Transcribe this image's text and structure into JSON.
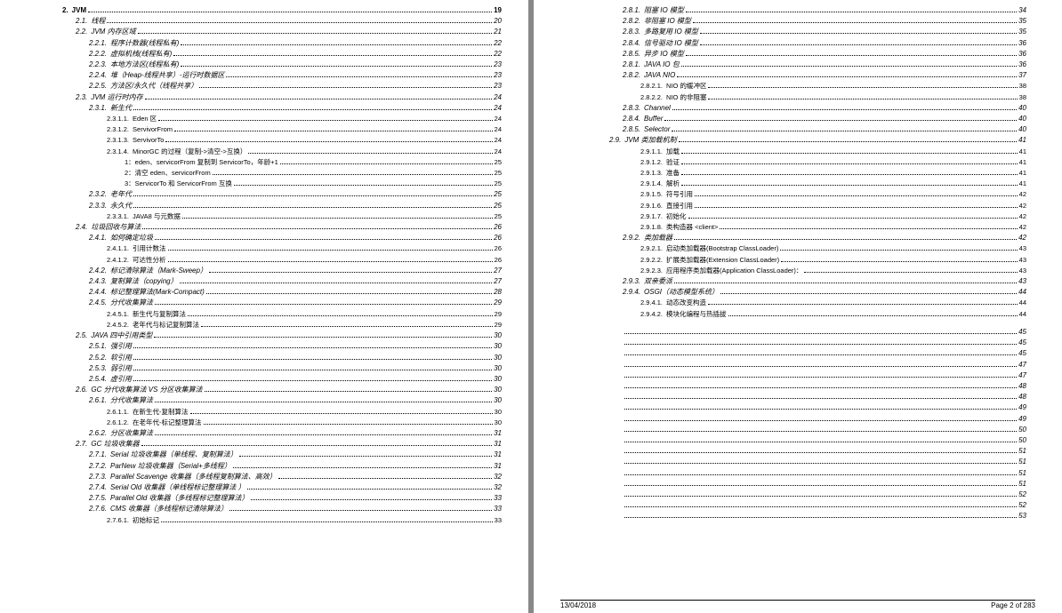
{
  "footer": {
    "date": "13/04/2018",
    "pageinfo": "Page 2 of 283"
  },
  "left": [
    {
      "lv": 1,
      "num": "2.",
      "t": "JVM",
      "p": "19"
    },
    {
      "lv": 2,
      "num": "2.1.",
      "t": "线程",
      "p": "20"
    },
    {
      "lv": 2,
      "num": "2.2.",
      "t": "JVM 内存区域",
      "p": "21"
    },
    {
      "lv": 3,
      "num": "2.2.1.",
      "t": "程序计数器(线程私有)",
      "p": "22"
    },
    {
      "lv": 3,
      "num": "2.2.2.",
      "t": "虚拟机栈(线程私有)",
      "p": "22"
    },
    {
      "lv": 3,
      "num": "2.2.3.",
      "t": "本地方法区(线程私有)",
      "p": "23"
    },
    {
      "lv": 3,
      "num": "2.2.4.",
      "t": "堆（Heap-线程共享）-运行时数据区",
      "p": "23"
    },
    {
      "lv": 3,
      "num": "2.2.5.",
      "t": "方法区/永久代（线程共享）",
      "p": "23"
    },
    {
      "lv": 2,
      "num": "2.3.",
      "t": "JVM 运行时内存",
      "p": "24"
    },
    {
      "lv": 3,
      "num": "2.3.1.",
      "t": "新生代",
      "p": "24"
    },
    {
      "lv": 4,
      "num": "2.3.1.1.",
      "t": "Eden 区",
      "p": "24"
    },
    {
      "lv": 4,
      "num": "2.3.1.2.",
      "t": "ServivorFrom",
      "p": "24"
    },
    {
      "lv": 4,
      "num": "2.3.1.3.",
      "t": "ServivorTo",
      "p": "24"
    },
    {
      "lv": 4,
      "num": "2.3.1.4.",
      "t": "MinorGC 的过程（复制->清空->互换）",
      "p": "24"
    },
    {
      "lv": 5,
      "num": "",
      "t": "1：eden、servicorFrom 复制到 ServicorTo，年龄+1",
      "p": "25"
    },
    {
      "lv": 5,
      "num": "",
      "t": "2：清空 eden、servicorFrom",
      "p": "25"
    },
    {
      "lv": 5,
      "num": "",
      "t": "3：ServicorTo 和 ServicorFrom 互换",
      "p": "25"
    },
    {
      "lv": 3,
      "num": "2.3.2.",
      "t": "老年代",
      "p": "25"
    },
    {
      "lv": 3,
      "num": "2.3.3.",
      "t": "永久代",
      "p": "25"
    },
    {
      "lv": 4,
      "num": "2.3.3.1.",
      "t": "JAVA8 与元数据",
      "p": "25"
    },
    {
      "lv": 2,
      "num": "2.4.",
      "t": "垃圾回收与算法",
      "p": "26"
    },
    {
      "lv": 3,
      "num": "2.4.1.",
      "t": "如何确定垃圾",
      "p": "26"
    },
    {
      "lv": 4,
      "num": "2.4.1.1.",
      "t": "引用计数法",
      "p": "26"
    },
    {
      "lv": 4,
      "num": "2.4.1.2.",
      "t": "可达性分析",
      "p": "26"
    },
    {
      "lv": 3,
      "num": "2.4.2.",
      "t": "标记清除算法（Mark-Sweep）",
      "p": "27"
    },
    {
      "lv": 3,
      "num": "2.4.3.",
      "t": "复制算法（copying）",
      "p": "27"
    },
    {
      "lv": 3,
      "num": "2.4.4.",
      "t": "标记整理算法(Mark-Compact)",
      "p": "28"
    },
    {
      "lv": 3,
      "num": "2.4.5.",
      "t": "分代收集算法",
      "p": "29"
    },
    {
      "lv": 4,
      "num": "2.4.5.1.",
      "t": "新生代与复制算法",
      "p": "29"
    },
    {
      "lv": 4,
      "num": "2.4.5.2.",
      "t": "老年代与标记复制算法",
      "p": "29"
    },
    {
      "lv": 2,
      "num": "2.5.",
      "t": "JAVA 四中引用类型",
      "p": "30"
    },
    {
      "lv": 3,
      "num": "2.5.1.",
      "t": "强引用",
      "p": "30"
    },
    {
      "lv": 3,
      "num": "2.5.2.",
      "t": "软引用",
      "p": "30"
    },
    {
      "lv": 3,
      "num": "2.5.3.",
      "t": "弱引用",
      "p": "30"
    },
    {
      "lv": 3,
      "num": "2.5.4.",
      "t": "虚引用",
      "p": "30"
    },
    {
      "lv": 2,
      "num": "2.6.",
      "t": "GC 分代收集算法 VS 分区收集算法",
      "p": "30"
    },
    {
      "lv": 3,
      "num": "2.6.1.",
      "t": "分代收集算法",
      "p": "30"
    },
    {
      "lv": 4,
      "num": "2.6.1.1.",
      "t": "在新生代-复制算法",
      "p": "30"
    },
    {
      "lv": 4,
      "num": "2.6.1.2.",
      "t": "在老年代-标记整理算法",
      "p": "30"
    },
    {
      "lv": 3,
      "num": "2.6.2.",
      "t": "分区收集算法",
      "p": "31"
    },
    {
      "lv": 2,
      "num": "2.7.",
      "t": "GC 垃圾收集器",
      "p": "31"
    },
    {
      "lv": 3,
      "num": "2.7.1.",
      "t": "Serial 垃圾收集器（单线程、复制算法）",
      "p": "31"
    },
    {
      "lv": 3,
      "num": "2.7.2.",
      "t": "ParNew 垃圾收集器（Serial+多线程）",
      "p": "31"
    },
    {
      "lv": 3,
      "num": "2.7.3.",
      "t": "Parallel Scavenge 收集器（多线程复制算法、高效）",
      "p": "32"
    },
    {
      "lv": 3,
      "num": "2.7.4.",
      "t": "Serial Old 收集器（单线程标记整理算法 ）",
      "p": "32"
    },
    {
      "lv": 3,
      "num": "2.7.5.",
      "t": "Parallel Old 收集器（多线程标记整理算法）",
      "p": "33"
    },
    {
      "lv": 3,
      "num": "2.7.6.",
      "t": "CMS 收集器（多线程标记清除算法）",
      "p": "33"
    },
    {
      "lv": 4,
      "num": "2.7.6.1.",
      "t": "初始标记",
      "p": "33"
    }
  ],
  "right": [
    {
      "lv": 3,
      "num": "2.8.1.",
      "t": "阻塞 IO 模型",
      "p": "34"
    },
    {
      "lv": 3,
      "num": "2.8.2.",
      "t": "非阻塞 IO 模型",
      "p": "35"
    },
    {
      "lv": 3,
      "num": "2.8.3.",
      "t": "多路复用 IO 模型",
      "p": "35"
    },
    {
      "lv": 3,
      "num": "2.8.4.",
      "t": "信号驱动 IO 模型",
      "p": "36"
    },
    {
      "lv": 3,
      "num": "2.8.5.",
      "t": "异步 IO 模型",
      "p": "36"
    },
    {
      "lv": 3,
      "num": "2.8.1.",
      "t": "JAVA IO 包",
      "p": "36"
    },
    {
      "lv": 3,
      "num": "2.8.2.",
      "t": "JAVA NIO",
      "p": "37"
    },
    {
      "lv": 4,
      "num": "2.8.2.1.",
      "t": "NIO 的缓冲区",
      "p": "38"
    },
    {
      "lv": 4,
      "num": "2.8.2.2.",
      "t": "NIO 的非阻塞",
      "p": "38"
    },
    {
      "lv": 3,
      "num": "2.8.3.",
      "t": "Channel",
      "p": "40"
    },
    {
      "lv": 3,
      "num": "2.8.4.",
      "t": "Buffer",
      "p": "40"
    },
    {
      "lv": 3,
      "num": "2.8.5.",
      "t": "Selector",
      "p": "40"
    },
    {
      "lv": 2,
      "num": "2.9.",
      "t": "JVM 类加载机制",
      "p": "41"
    },
    {
      "lv": 4,
      "num": "2.9.1.1.",
      "t": "加载",
      "p": "41"
    },
    {
      "lv": 4,
      "num": "2.9.1.2.",
      "t": "验证",
      "p": "41"
    },
    {
      "lv": 4,
      "num": "2.9.1.3.",
      "t": "准备",
      "p": "41"
    },
    {
      "lv": 4,
      "num": "2.9.1.4.",
      "t": "解析",
      "p": "41"
    },
    {
      "lv": 4,
      "num": "2.9.1.5.",
      "t": "符号引用",
      "p": "42"
    },
    {
      "lv": 4,
      "num": "2.9.1.6.",
      "t": "直接引用",
      "p": "42"
    },
    {
      "lv": 4,
      "num": "2.9.1.7.",
      "t": "初始化",
      "p": "42"
    },
    {
      "lv": 4,
      "num": "2.9.1.8.",
      "t": "类构造器 <client>",
      "p": "42"
    },
    {
      "lv": 3,
      "num": "2.9.2.",
      "t": "类加载器",
      "p": "42"
    },
    {
      "lv": 4,
      "num": "2.9.2.1.",
      "t": "启动类加载器(Bootstrap ClassLoader)",
      "p": "43"
    },
    {
      "lv": 4,
      "num": "2.9.2.2.",
      "t": "扩展类加载器(Extension ClassLoader)",
      "p": "43"
    },
    {
      "lv": 4,
      "num": "2.9.2.3.",
      "t": "应用程序类加载器(Application ClassLoader)：",
      "p": "43"
    },
    {
      "lv": 3,
      "num": "2.9.3.",
      "t": "双亲委派",
      "p": "43"
    },
    {
      "lv": 3,
      "num": "2.9.4.",
      "t": "OSGI（动态模型系统）",
      "p": "44"
    },
    {
      "lv": 4,
      "num": "2.9.4.1.",
      "t": "动态改变构造",
      "p": "44"
    },
    {
      "lv": 4,
      "num": "2.9.4.2.",
      "t": "模块化编程与热插拔",
      "p": "44"
    }
  ],
  "right_tail": [
    {
      "p": "45",
      "gap": true
    },
    {
      "p": "45"
    },
    {
      "p": "45"
    },
    {
      "p": "47"
    },
    {
      "p": "47"
    },
    {
      "p": "48"
    },
    {
      "p": "48"
    },
    {
      "p": "49"
    },
    {
      "p": "49"
    },
    {
      "p": "50"
    },
    {
      "p": "50"
    },
    {
      "p": "51"
    },
    {
      "p": "51"
    },
    {
      "p": "51"
    },
    {
      "p": "51"
    },
    {
      "p": "52"
    },
    {
      "p": "52"
    },
    {
      "p": "53"
    }
  ]
}
